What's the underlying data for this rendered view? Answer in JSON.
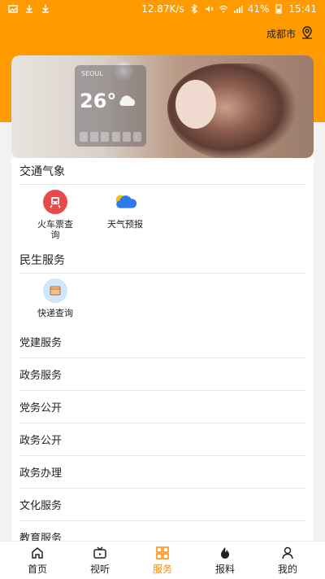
{
  "status_bar": {
    "speed": "12.87K/s",
    "battery": "41%",
    "time": "15:41"
  },
  "header": {
    "location": "成都市"
  },
  "banner": {
    "city": "SEOUL",
    "temp": "26°"
  },
  "sections": [
    {
      "title": "交通气象",
      "items": [
        {
          "label": "火车票查\n询",
          "icon": "train-ticket-icon"
        },
        {
          "label": "天气预报",
          "icon": "weather-icon"
        }
      ]
    },
    {
      "title": "民生服务",
      "items": [
        {
          "label": "快递查询",
          "icon": "express-icon"
        }
      ]
    }
  ],
  "list": [
    "党建服务",
    "政务服务",
    "党务公开",
    "政务公开",
    "政务办理",
    "文化服务",
    "教育服务"
  ],
  "bottom_nav": [
    {
      "label": "首页",
      "icon": "home-icon",
      "active": false
    },
    {
      "label": "视听",
      "icon": "tv-icon",
      "active": false
    },
    {
      "label": "服务",
      "icon": "grid-icon",
      "active": true
    },
    {
      "label": "报料",
      "icon": "fire-icon",
      "active": false
    },
    {
      "label": "我的",
      "icon": "user-icon",
      "active": false
    }
  ],
  "colors": {
    "accent": "#ff9a00",
    "active_nav": "#ff8a00"
  }
}
